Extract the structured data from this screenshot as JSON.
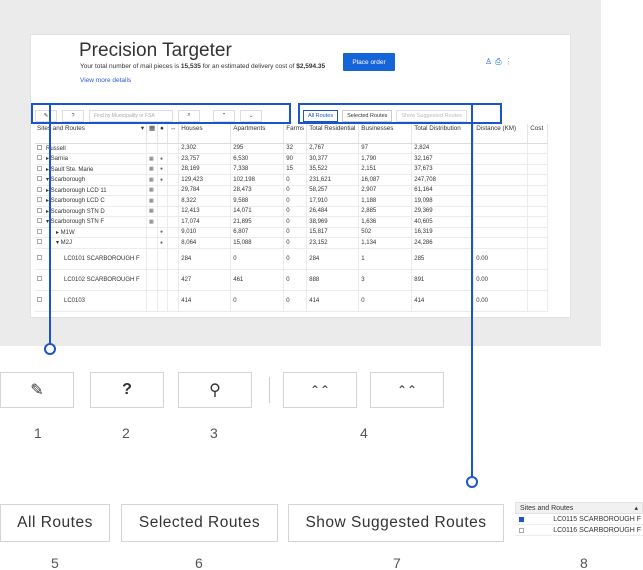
{
  "app": {
    "title": "Precision Targeter",
    "subtitle_prefix": "Your total number of mail pieces is ",
    "mail_pieces": "15,535",
    "subtitle_mid": " for an estimated delivery cost of ",
    "delivery_cost": "$2,594.35",
    "view_more": "View more details",
    "place_order": "Place order",
    "header_icons": "♙ ⎙ ⋮"
  },
  "toolbar": {
    "search_placeholder": "Find by Municipality or FSA",
    "help_label": "?",
    "search_icon_glyph": "⌕"
  },
  "route_buttons": {
    "all": "All Routes",
    "selected": "Selected Routes",
    "suggested": "Show Suggested Routes"
  },
  "table": {
    "columns": [
      "Sites and Routes",
      "",
      "",
      "",
      "Houses",
      "Apartments",
      "Farms",
      "Total Residential",
      "Businesses",
      "Total Distribution",
      "Distance (KM)",
      "Cost"
    ],
    "rows": [
      {
        "name": "Russell",
        "houses": "2,302",
        "apartments": "295",
        "farms": "32",
        "total_res": "2,767",
        "businesses": "97",
        "total_dist": "2,824",
        "distance": ""
      },
      {
        "name": "▸ Sarnia",
        "houses": "23,757",
        "apartments": "6,530",
        "farms": "90",
        "total_res": "30,377",
        "businesses": "1,790",
        "total_dist": "32,167",
        "distance": ""
      },
      {
        "name": "▸ Sault Ste. Marie",
        "houses": "28,169",
        "apartments": "7,338",
        "farms": "15",
        "total_res": "35,522",
        "businesses": "2,151",
        "total_dist": "37,673",
        "distance": ""
      },
      {
        "name": "▾ Scarborough",
        "houses": "129,423",
        "apartments": "102,198",
        "farms": "0",
        "total_res": "231,621",
        "businesses": "16,087",
        "total_dist": "247,708",
        "distance": ""
      },
      {
        "name": "▸ Scarborough LCD 11",
        "houses": "29,784",
        "apartments": "28,473",
        "farms": "0",
        "total_res": "58,257",
        "businesses": "2,907",
        "total_dist": "61,164",
        "distance": ""
      },
      {
        "name": "▸ Scarborough LCD C",
        "houses": "8,322",
        "apartments": "9,588",
        "farms": "0",
        "total_res": "17,910",
        "businesses": "1,188",
        "total_dist": "19,098",
        "distance": ""
      },
      {
        "name": "▸ Scarborough STN D",
        "houses": "12,413",
        "apartments": "14,071",
        "farms": "0",
        "total_res": "26,484",
        "businesses": "2,885",
        "total_dist": "29,369",
        "distance": ""
      },
      {
        "name": "▾ Scarborough STN F",
        "houses": "17,074",
        "apartments": "21,895",
        "farms": "0",
        "total_res": "38,969",
        "businesses": "1,636",
        "total_dist": "40,605",
        "distance": ""
      },
      {
        "name": "▸ M1W",
        "houses": "9,010",
        "apartments": "6,807",
        "farms": "0",
        "total_res": "15,817",
        "businesses": "502",
        "total_dist": "16,319",
        "distance": ""
      },
      {
        "name": "▾ M2J",
        "houses": "8,064",
        "apartments": "15,088",
        "farms": "0",
        "total_res": "23,152",
        "businesses": "1,134",
        "total_dist": "24,286",
        "distance": ""
      },
      {
        "name": "LC0101 SCARBOROUGH F",
        "houses": "284",
        "apartments": "0",
        "farms": "0",
        "total_res": "284",
        "businesses": "1",
        "total_dist": "285",
        "distance": "0.00"
      },
      {
        "name": "LC0102 SCARBOROUGH F",
        "houses": "427",
        "apartments": "461",
        "farms": "0",
        "total_res": "888",
        "businesses": "3",
        "total_dist": "891",
        "distance": "0.00"
      },
      {
        "name": "LC0103",
        "houses": "414",
        "apartments": "0",
        "farms": "0",
        "total_res": "414",
        "businesses": "0",
        "total_dist": "414",
        "distance": "0.00"
      }
    ]
  },
  "zoom": {
    "pencil_icon": "✎",
    "help": "?",
    "search_icon": "⚲",
    "expand_all_icon": "⌃⌃",
    "collapse_all_icon": "⌃⌃",
    "all_routes": "All Routes",
    "selected_routes": "Selected Routes",
    "show_suggested_routes": "Show Suggested Routes"
  },
  "numbers": [
    "1",
    "2",
    "3",
    "4",
    "5",
    "6",
    "7",
    "8"
  ],
  "mini_table": {
    "header": "Sites and Routes",
    "sort_icon": "▴",
    "rows": [
      {
        "label": "LC0115 SCARBOROUGH F",
        "checked": true
      },
      {
        "label": "LC0116 SCARBOROUGH F",
        "checked": false
      }
    ]
  },
  "colors": {
    "accent": "#1a56c7",
    "primary_button": "#1565d8"
  }
}
